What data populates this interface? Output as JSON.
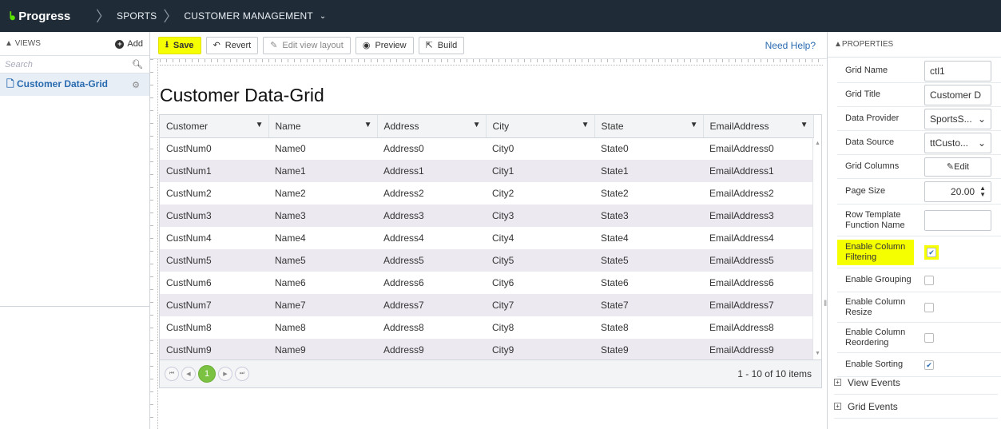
{
  "topbar": {
    "logo": "Progress",
    "breadcrumbs": [
      "SPORTS",
      "CUSTOMER MANAGEMENT"
    ]
  },
  "views": {
    "header": "VIEWS",
    "add_label": "Add",
    "search_placeholder": "Search",
    "items": [
      {
        "label": "Customer Data-Grid"
      }
    ]
  },
  "toolbar": {
    "save": "Save",
    "revert": "Revert",
    "edit_layout": "Edit view layout",
    "preview": "Preview",
    "build": "Build",
    "help": "Need Help?"
  },
  "grid": {
    "title": "Customer Data-Grid",
    "columns": [
      "Customer",
      "Name",
      "Address",
      "City",
      "State",
      "EmailAddress"
    ],
    "rows": [
      [
        "CustNum0",
        "Name0",
        "Address0",
        "City0",
        "State0",
        "EmailAddress0"
      ],
      [
        "CustNum1",
        "Name1",
        "Address1",
        "City1",
        "State1",
        "EmailAddress1"
      ],
      [
        "CustNum2",
        "Name2",
        "Address2",
        "City2",
        "State2",
        "EmailAddress2"
      ],
      [
        "CustNum3",
        "Name3",
        "Address3",
        "City3",
        "State3",
        "EmailAddress3"
      ],
      [
        "CustNum4",
        "Name4",
        "Address4",
        "City4",
        "State4",
        "EmailAddress4"
      ],
      [
        "CustNum5",
        "Name5",
        "Address5",
        "City5",
        "State5",
        "EmailAddress5"
      ],
      [
        "CustNum6",
        "Name6",
        "Address6",
        "City6",
        "State6",
        "EmailAddress6"
      ],
      [
        "CustNum7",
        "Name7",
        "Address7",
        "City7",
        "State7",
        "EmailAddress7"
      ],
      [
        "CustNum8",
        "Name8",
        "Address8",
        "City8",
        "State8",
        "EmailAddress8"
      ],
      [
        "CustNum9",
        "Name9",
        "Address9",
        "City9",
        "State9",
        "EmailAddress9"
      ]
    ],
    "pager": {
      "current_page": "1",
      "info": "1 - 10 of 10 items"
    }
  },
  "properties": {
    "header": "PROPERTIES",
    "grid_name_label": "Grid Name",
    "grid_name_value": "ctl1",
    "grid_title_label": "Grid Title",
    "grid_title_value": "Customer D",
    "data_provider_label": "Data Provider",
    "data_provider_value": "SportsS...",
    "data_source_label": "Data Source",
    "data_source_value": "ttCusto...",
    "grid_columns_label": "Grid Columns",
    "grid_columns_button": "Edit",
    "page_size_label": "Page Size",
    "page_size_value": "20.00",
    "row_template_label": "Row Template Function Name",
    "row_template_value": "",
    "enable_column_filtering_label": "Enable Column Filtering",
    "enable_column_filtering": true,
    "enable_grouping_label": "Enable Grouping",
    "enable_grouping": false,
    "enable_column_resize_label": "Enable Column Resize",
    "enable_column_resize": false,
    "enable_column_reordering_label": "Enable Column Reordering",
    "enable_column_reordering": false,
    "enable_sorting_label": "Enable Sorting",
    "enable_sorting": true,
    "view_events_label": "View Events",
    "grid_events_label": "Grid Events"
  },
  "colors": {
    "topbar": "#1f2c38",
    "highlight": "#f6ff00",
    "pager_active": "#7cc242",
    "link": "#2a6bb0"
  }
}
